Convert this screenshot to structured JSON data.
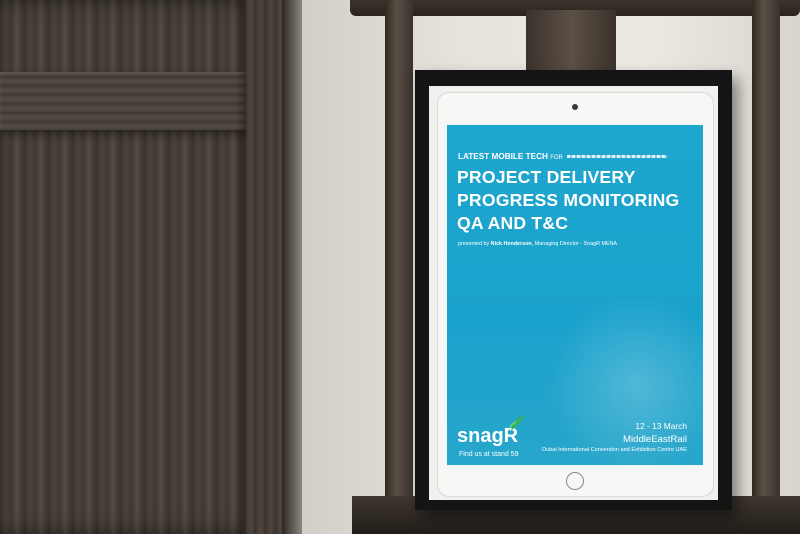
{
  "poster": {
    "kicker": "LATEST MOBILE TECH",
    "kicker_suffix": "FOR",
    "headline_line1": "PROJECT DELIVERY",
    "headline_line2": "PROGRESS MONITORING",
    "headline_line3": "QA AND T&C",
    "presented_prefix": "presented by",
    "presenter": "Nick Henderson",
    "presenter_role": ", Managing Director - SnagR MENA",
    "logo": "snagR",
    "stand": "Find us at stand 59",
    "dates": "12 - 13 March",
    "event": "MiddleEastRail",
    "venue": "Dubai International Convention and Exhibition Centre UAE"
  },
  "colors": {
    "screen": "#1ea6cf",
    "frame": "#141414",
    "wood": "#3f3832"
  }
}
